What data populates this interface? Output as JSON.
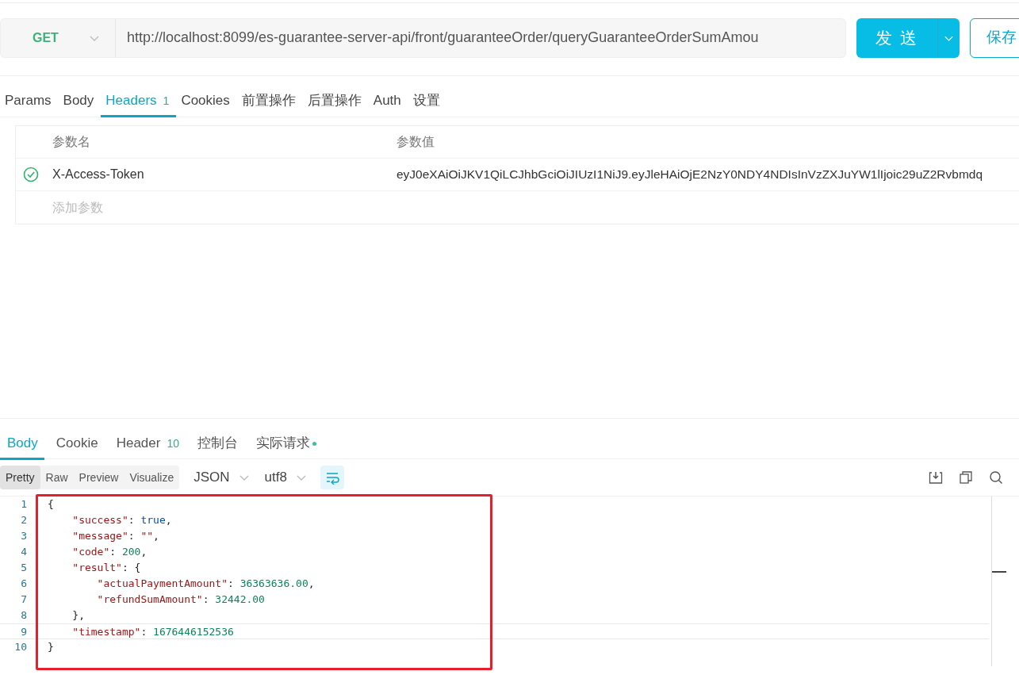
{
  "request": {
    "method": "GET",
    "url": "http://localhost:8099/es-guarantee-server-api/front/guaranteeOrder/queryGuaranteeOrderSumAmou",
    "send_label": "发 送",
    "save_label": "保存"
  },
  "request_tabs": [
    {
      "label": "Params",
      "selected": false
    },
    {
      "label": "Body",
      "selected": false
    },
    {
      "label": "Headers",
      "count": "1",
      "selected": true
    },
    {
      "label": "Cookies",
      "selected": false
    },
    {
      "label": "前置操作",
      "selected": false
    },
    {
      "label": "后置操作",
      "selected": false
    },
    {
      "label": "Auth",
      "selected": false
    },
    {
      "label": "设置",
      "selected": false
    }
  ],
  "headers_table": {
    "columns": [
      "参数名",
      "参数值"
    ],
    "rows": [
      {
        "enabled": true,
        "name": "X-Access-Token",
        "value": "eyJ0eXAiOiJKV1QiLCJhbGciOiJIUzI1NiJ9.eyJleHAiOjE2NzY0NDY4NDIsInVzZXJuYW1lIjoic29uZ2Rvbmdq"
      }
    ],
    "add_placeholder": "添加参数"
  },
  "response_tabs": [
    {
      "label": "Body",
      "selected": true
    },
    {
      "label": "Cookie",
      "selected": false
    },
    {
      "label": "Header",
      "count": "10",
      "selected": false
    },
    {
      "label": "控制台",
      "selected": false
    },
    {
      "label": "实际请求",
      "dot": true,
      "selected": false
    }
  ],
  "view_modes": [
    {
      "label": "Pretty",
      "selected": true
    },
    {
      "label": "Raw",
      "selected": false
    },
    {
      "label": "Preview",
      "selected": false
    },
    {
      "label": "Visualize",
      "selected": false
    }
  ],
  "format": "JSON",
  "encoding": "utf8",
  "wrap_on": true,
  "code_lines": [
    {
      "number": "1",
      "current": false,
      "tokens": [
        {
          "kind": "punct",
          "text": "{"
        }
      ]
    },
    {
      "number": "2",
      "current": false,
      "tokens": [
        {
          "kind": "key",
          "text": "    \"success\""
        },
        {
          "kind": "punct",
          "text": ": "
        },
        {
          "kind": "bool",
          "text": "true"
        },
        {
          "kind": "punct",
          "text": ","
        }
      ]
    },
    {
      "number": "3",
      "current": false,
      "tokens": [
        {
          "kind": "key",
          "text": "    \"message\""
        },
        {
          "kind": "punct",
          "text": ": "
        },
        {
          "kind": "string",
          "text": "\"\""
        },
        {
          "kind": "punct",
          "text": ","
        }
      ]
    },
    {
      "number": "4",
      "current": false,
      "tokens": [
        {
          "kind": "key",
          "text": "    \"code\""
        },
        {
          "kind": "punct",
          "text": ": "
        },
        {
          "kind": "number",
          "text": "200"
        },
        {
          "kind": "punct",
          "text": ","
        }
      ]
    },
    {
      "number": "5",
      "current": false,
      "tokens": [
        {
          "kind": "key",
          "text": "    \"result\""
        },
        {
          "kind": "punct",
          "text": ": {"
        }
      ]
    },
    {
      "number": "6",
      "current": false,
      "tokens": [
        {
          "kind": "key",
          "text": "        \"actualPaymentAmount\""
        },
        {
          "kind": "punct",
          "text": ": "
        },
        {
          "kind": "number",
          "text": "36363636.00"
        },
        {
          "kind": "punct",
          "text": ","
        }
      ]
    },
    {
      "number": "7",
      "current": false,
      "tokens": [
        {
          "kind": "key",
          "text": "        \"refundSumAmount\""
        },
        {
          "kind": "punct",
          "text": ": "
        },
        {
          "kind": "number",
          "text": "32442.00"
        }
      ]
    },
    {
      "number": "8",
      "current": false,
      "tokens": [
        {
          "kind": "punct",
          "text": "    },"
        }
      ]
    },
    {
      "number": "9",
      "current": true,
      "tokens": [
        {
          "kind": "key",
          "text": "    \"timestamp\""
        },
        {
          "kind": "punct",
          "text": ": "
        },
        {
          "kind": "number",
          "text": "1676446152536"
        }
      ]
    },
    {
      "number": "10",
      "current": false,
      "tokens": [
        {
          "kind": "punct",
          "text": "}"
        }
      ]
    }
  ],
  "annotation": {
    "kind": "highlight-frame",
    "color": "#e3202c"
  }
}
